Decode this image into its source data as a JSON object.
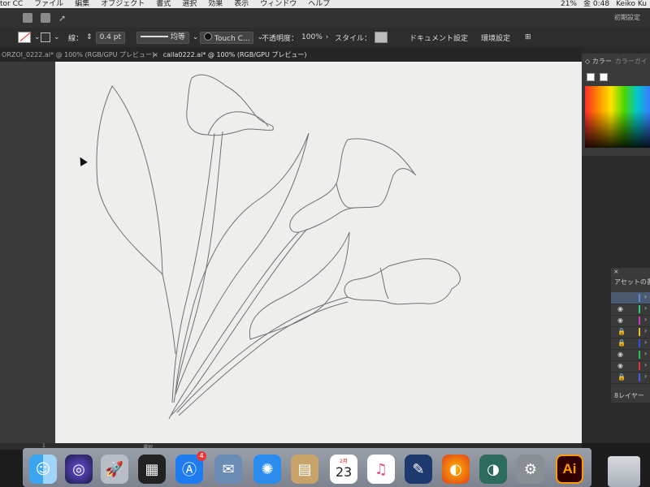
{
  "menubar": {
    "app": "tor CC",
    "items": [
      "ファイル",
      "編集",
      "オブジェクト",
      "書式",
      "選択",
      "効果",
      "表示",
      "ウィンドウ",
      "ヘルプ"
    ],
    "battery": "21%",
    "clock": "金 0:48",
    "user": "Keiko Ku"
  },
  "appbar": {
    "workspace": "初期設定",
    "search_icon": "search-icon"
  },
  "control_bar": {
    "stroke_label": "線：",
    "stroke_value": "0.4 pt",
    "profile": "均等",
    "brush": "Touch C...",
    "opacity_label": "不透明度：",
    "opacity_value": "100%",
    "style_label": "スタイル：",
    "doc_settings": "ドキュメント設定",
    "preferences": "環境設定"
  },
  "tabs": [
    {
      "label": "ORZOI_0222.ai* @ 100% (RGB/GPU プレビュー)"
    },
    {
      "label": "calla0222.ai* @ 100% (RGB/GPU プレビュー)"
    }
  ],
  "color_panel": {
    "title": "カラー",
    "tab2": "カラーガイ"
  },
  "assets_panel": {
    "title": "アセットの書",
    "footer": "8レイヤー",
    "layers": [
      {
        "color": "#5a8ad0",
        "icon": "eye-icon"
      },
      {
        "color": "#2ecc71",
        "icon": "eye-icon"
      },
      {
        "color": "#c040c0",
        "icon": "eye-icon"
      },
      {
        "color": "#e8c020",
        "icon": "lock-icon"
      },
      {
        "color": "#3050e0",
        "icon": "lock-icon"
      },
      {
        "color": "#30c050",
        "icon": "eye-icon"
      },
      {
        "color": "#e03030",
        "icon": "eye-icon"
      },
      {
        "color": "#4060e0",
        "icon": "lock-icon"
      }
    ]
  },
  "status": {
    "zoom": "1",
    "tool": "選択"
  },
  "dock": {
    "calendar_month": "2月",
    "calendar_day": "23",
    "appstore_badge": "4",
    "illustrator": "Ai"
  }
}
